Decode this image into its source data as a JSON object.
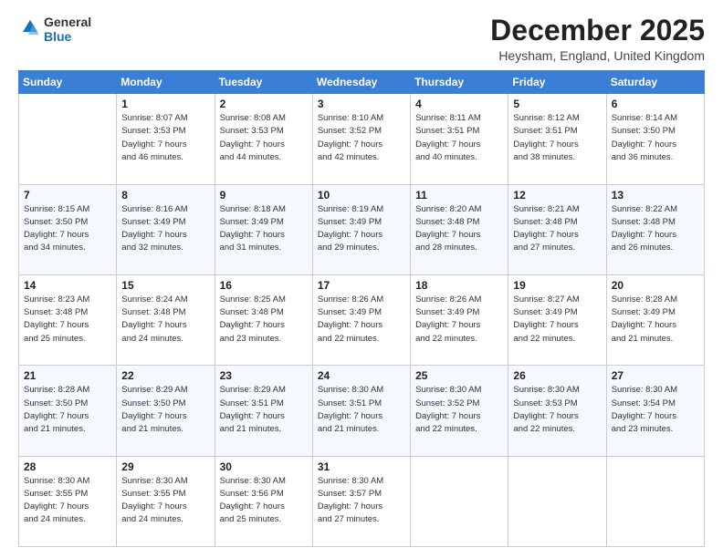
{
  "header": {
    "logo_line1": "General",
    "logo_line2": "Blue",
    "month": "December 2025",
    "location": "Heysham, England, United Kingdom"
  },
  "days_of_week": [
    "Sunday",
    "Monday",
    "Tuesday",
    "Wednesday",
    "Thursday",
    "Friday",
    "Saturday"
  ],
  "weeks": [
    [
      {
        "day": "",
        "info": ""
      },
      {
        "day": "1",
        "info": "Sunrise: 8:07 AM\nSunset: 3:53 PM\nDaylight: 7 hours\nand 46 minutes."
      },
      {
        "day": "2",
        "info": "Sunrise: 8:08 AM\nSunset: 3:53 PM\nDaylight: 7 hours\nand 44 minutes."
      },
      {
        "day": "3",
        "info": "Sunrise: 8:10 AM\nSunset: 3:52 PM\nDaylight: 7 hours\nand 42 minutes."
      },
      {
        "day": "4",
        "info": "Sunrise: 8:11 AM\nSunset: 3:51 PM\nDaylight: 7 hours\nand 40 minutes."
      },
      {
        "day": "5",
        "info": "Sunrise: 8:12 AM\nSunset: 3:51 PM\nDaylight: 7 hours\nand 38 minutes."
      },
      {
        "day": "6",
        "info": "Sunrise: 8:14 AM\nSunset: 3:50 PM\nDaylight: 7 hours\nand 36 minutes."
      }
    ],
    [
      {
        "day": "7",
        "info": "Sunrise: 8:15 AM\nSunset: 3:50 PM\nDaylight: 7 hours\nand 34 minutes."
      },
      {
        "day": "8",
        "info": "Sunrise: 8:16 AM\nSunset: 3:49 PM\nDaylight: 7 hours\nand 32 minutes."
      },
      {
        "day": "9",
        "info": "Sunrise: 8:18 AM\nSunset: 3:49 PM\nDaylight: 7 hours\nand 31 minutes."
      },
      {
        "day": "10",
        "info": "Sunrise: 8:19 AM\nSunset: 3:49 PM\nDaylight: 7 hours\nand 29 minutes."
      },
      {
        "day": "11",
        "info": "Sunrise: 8:20 AM\nSunset: 3:48 PM\nDaylight: 7 hours\nand 28 minutes."
      },
      {
        "day": "12",
        "info": "Sunrise: 8:21 AM\nSunset: 3:48 PM\nDaylight: 7 hours\nand 27 minutes."
      },
      {
        "day": "13",
        "info": "Sunrise: 8:22 AM\nSunset: 3:48 PM\nDaylight: 7 hours\nand 26 minutes."
      }
    ],
    [
      {
        "day": "14",
        "info": "Sunrise: 8:23 AM\nSunset: 3:48 PM\nDaylight: 7 hours\nand 25 minutes."
      },
      {
        "day": "15",
        "info": "Sunrise: 8:24 AM\nSunset: 3:48 PM\nDaylight: 7 hours\nand 24 minutes."
      },
      {
        "day": "16",
        "info": "Sunrise: 8:25 AM\nSunset: 3:48 PM\nDaylight: 7 hours\nand 23 minutes."
      },
      {
        "day": "17",
        "info": "Sunrise: 8:26 AM\nSunset: 3:49 PM\nDaylight: 7 hours\nand 22 minutes."
      },
      {
        "day": "18",
        "info": "Sunrise: 8:26 AM\nSunset: 3:49 PM\nDaylight: 7 hours\nand 22 minutes."
      },
      {
        "day": "19",
        "info": "Sunrise: 8:27 AM\nSunset: 3:49 PM\nDaylight: 7 hours\nand 22 minutes."
      },
      {
        "day": "20",
        "info": "Sunrise: 8:28 AM\nSunset: 3:49 PM\nDaylight: 7 hours\nand 21 minutes."
      }
    ],
    [
      {
        "day": "21",
        "info": "Sunrise: 8:28 AM\nSunset: 3:50 PM\nDaylight: 7 hours\nand 21 minutes."
      },
      {
        "day": "22",
        "info": "Sunrise: 8:29 AM\nSunset: 3:50 PM\nDaylight: 7 hours\nand 21 minutes."
      },
      {
        "day": "23",
        "info": "Sunrise: 8:29 AM\nSunset: 3:51 PM\nDaylight: 7 hours\nand 21 minutes."
      },
      {
        "day": "24",
        "info": "Sunrise: 8:30 AM\nSunset: 3:51 PM\nDaylight: 7 hours\nand 21 minutes."
      },
      {
        "day": "25",
        "info": "Sunrise: 8:30 AM\nSunset: 3:52 PM\nDaylight: 7 hours\nand 22 minutes."
      },
      {
        "day": "26",
        "info": "Sunrise: 8:30 AM\nSunset: 3:53 PM\nDaylight: 7 hours\nand 22 minutes."
      },
      {
        "day": "27",
        "info": "Sunrise: 8:30 AM\nSunset: 3:54 PM\nDaylight: 7 hours\nand 23 minutes."
      }
    ],
    [
      {
        "day": "28",
        "info": "Sunrise: 8:30 AM\nSunset: 3:55 PM\nDaylight: 7 hours\nand 24 minutes."
      },
      {
        "day": "29",
        "info": "Sunrise: 8:30 AM\nSunset: 3:55 PM\nDaylight: 7 hours\nand 24 minutes."
      },
      {
        "day": "30",
        "info": "Sunrise: 8:30 AM\nSunset: 3:56 PM\nDaylight: 7 hours\nand 25 minutes."
      },
      {
        "day": "31",
        "info": "Sunrise: 8:30 AM\nSunset: 3:57 PM\nDaylight: 7 hours\nand 27 minutes."
      },
      {
        "day": "",
        "info": ""
      },
      {
        "day": "",
        "info": ""
      },
      {
        "day": "",
        "info": ""
      }
    ]
  ]
}
